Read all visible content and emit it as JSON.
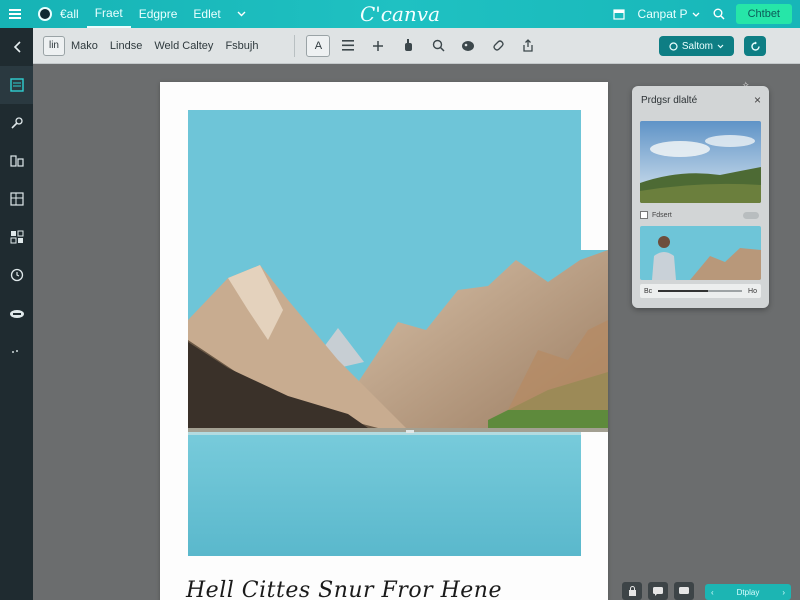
{
  "app": {
    "brand": "C'canva",
    "menu": [
      "Fraet",
      "Edgpre",
      "Edlet"
    ],
    "file_label": "€all",
    "project_label": "Canpat P",
    "share_label": "Chtbet"
  },
  "toolbar": {
    "icon_box_label": "lin",
    "items": [
      "Mako",
      "Lindse",
      "Weld Caltey",
      "Fsbujh"
    ],
    "text_tool_label": "A",
    "publish_label": "Saltom"
  },
  "canvas": {
    "caption": "Hell Cittes Snur Fror Hene"
  },
  "panel": {
    "title": "Prdgsr dlalté",
    "close_symbol": "×",
    "row1_label": "Fdsert",
    "media_time": "Bc",
    "media_end": "Ho",
    "media_progress": 0.6
  },
  "bottom": {
    "pill_label": "Dtplay"
  },
  "colors": {
    "topbar": "#1fc1c2",
    "rail": "#1f2b30",
    "share": "#26e6a8",
    "sky": "#6ec5d8",
    "water": "#6cc3d4"
  },
  "icons": {
    "rail": [
      "chevron-left-icon",
      "template-icon",
      "brush-icon",
      "layers-icon",
      "grid-icon",
      "qr-icon",
      "clock-icon",
      "cloud-icon",
      "more-icon"
    ],
    "toolbar": [
      "list-icon",
      "plus-icon",
      "hand-icon",
      "search-icon",
      "palette-icon",
      "link-icon",
      "share-icon"
    ]
  }
}
